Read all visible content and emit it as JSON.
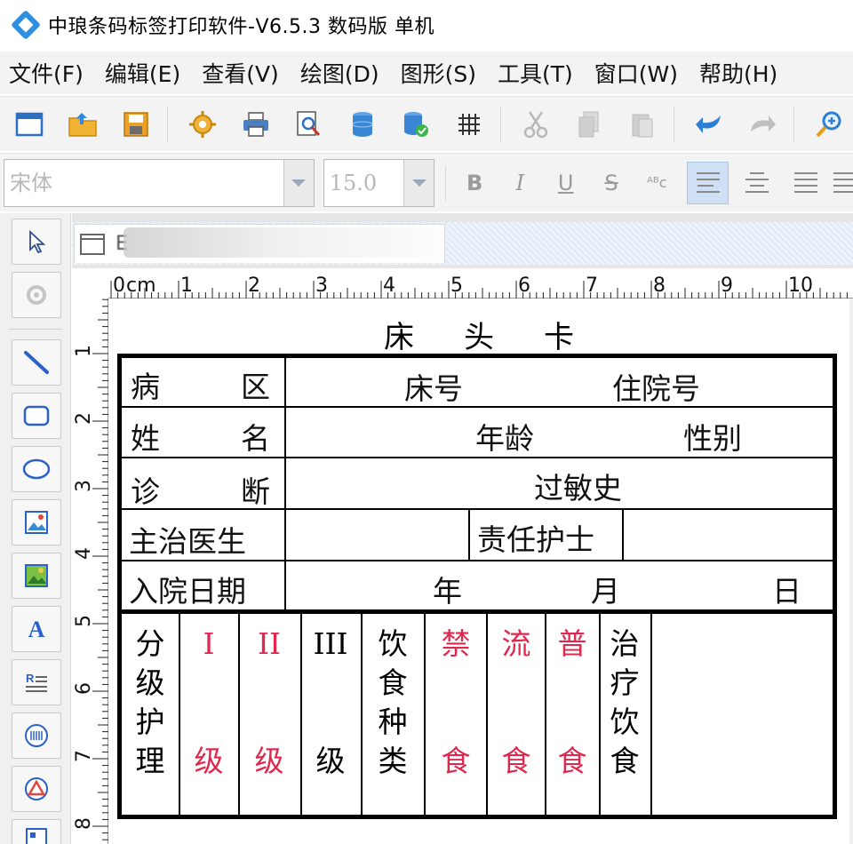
{
  "app": {
    "title": "中琅条码标签打印软件-V6.5.3 数码版 单机"
  },
  "menu": [
    {
      "label": "文件(F)"
    },
    {
      "label": "编辑(E)"
    },
    {
      "label": "查看(V)"
    },
    {
      "label": "绘图(D)"
    },
    {
      "label": "图形(S)"
    },
    {
      "label": "工具(T)"
    },
    {
      "label": "窗口(W)"
    },
    {
      "label": "帮助(H)"
    }
  ],
  "toolbar": {
    "icons": [
      "new-icon",
      "open-icon",
      "save-icon",
      "settings-icon",
      "print-icon",
      "print-preview-icon",
      "database-icon",
      "database-connect-icon",
      "grid-icon",
      "cut-icon",
      "copy-icon",
      "paste-icon",
      "undo-icon",
      "redo-icon",
      "zoom-in-icon"
    ]
  },
  "format": {
    "font_family": "宋体",
    "font_size": "15.0",
    "bold": "B",
    "italic": "I",
    "underline": "U",
    "strike": "S",
    "abc": "ᴬᴮc"
  },
  "document": {
    "tab_label": "E"
  },
  "ruler": {
    "unit": "cm",
    "h_labels": [
      "0",
      "1",
      "2",
      "3",
      "4",
      "5",
      "6",
      "7",
      "8",
      "9",
      "10"
    ],
    "v_labels": [
      "1",
      "2",
      "3",
      "4",
      "5",
      "6",
      "7",
      "8"
    ]
  },
  "card": {
    "title": [
      "床",
      "头",
      "卡"
    ],
    "row1": {
      "a": "病",
      "b": "区",
      "bed_no": "床号",
      "admission_no": "住院号"
    },
    "row2": {
      "a": "姓",
      "b": "名",
      "age": "年龄",
      "gender": "性别"
    },
    "row3": {
      "a": "诊",
      "b": "断",
      "allergy": "过敏史"
    },
    "row4": {
      "doctor": "主治医生",
      "nurse": "责任护士"
    },
    "row5": {
      "date": "入院日期",
      "year": "年",
      "month": "月",
      "day": "日"
    },
    "columns": [
      {
        "text": [
          "分",
          "级",
          "护",
          "理"
        ],
        "color": "#111111"
      },
      {
        "top": "I",
        "bottom": "级",
        "color": "#e0284f"
      },
      {
        "top": "II",
        "bottom": "级",
        "color": "#e0284f"
      },
      {
        "top": "III",
        "bottom": "级",
        "color": "#111111"
      },
      {
        "text": [
          "饮",
          "食",
          "种",
          "类"
        ],
        "color": "#111111"
      },
      {
        "top": "禁",
        "bottom": "食",
        "color": "#e0284f"
      },
      {
        "top": "流",
        "bottom": "食",
        "color": "#e0284f"
      },
      {
        "top": "普",
        "bottom": "食",
        "color": "#e0284f"
      },
      {
        "text": [
          "治",
          "疗",
          "饮",
          "食"
        ],
        "color": "#111111"
      }
    ]
  },
  "colors": {
    "accent": "#e0284f",
    "selection": "#cfe0f5"
  }
}
